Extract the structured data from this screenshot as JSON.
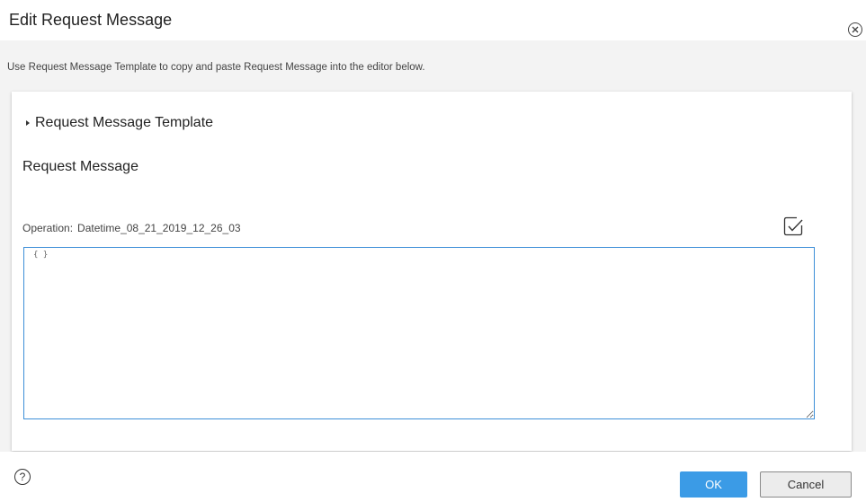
{
  "dialog": {
    "title": "Edit Request Message",
    "close_icon": "close-circle-icon"
  },
  "instructions": "Use Request Message Template to copy and paste Request Message into the editor below.",
  "template_section": {
    "label": "Request Message Template",
    "expanded": false,
    "icon": "caret-right-icon"
  },
  "request_message": {
    "title": "Request Message",
    "operation_label": "Operation:",
    "operation_value": "Datetime_08_21_2019_12_26_03",
    "validate_icon": "validate-check-icon",
    "editor_value": "{ }"
  },
  "footer": {
    "help_icon": "help-icon",
    "help_glyph": "?",
    "ok_label": "OK",
    "cancel_label": "Cancel"
  },
  "colors": {
    "primary_button": "#3b9be6",
    "editor_border": "#3d8fd8",
    "content_background": "#f3f3f3"
  }
}
